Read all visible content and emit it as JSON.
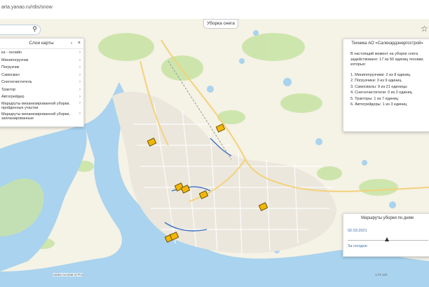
{
  "browser": {
    "url": "arta.yanao.ru/rdis/snow"
  },
  "map": {
    "search_icon": "search-icon",
    "top_button": "Уборка снега",
    "star_icon": "star-icon",
    "attribution": "Adobe Acrobat XI Pro",
    "scale": "1:72 124"
  },
  "layers_panel": {
    "title": "Слои карты",
    "items": [
      {
        "label": "ка - онлайн"
      },
      {
        "label": "Минипогрузчик"
      },
      {
        "label": "Погрузчик"
      },
      {
        "label": "Самосвал"
      },
      {
        "label": "Снегоочиститель"
      },
      {
        "label": "Трактор"
      },
      {
        "label": "Автогрейдер"
      },
      {
        "label": "Маршруты механизированной уборки, пройденные участки"
      },
      {
        "label": "Маршруты механизированной уборки, запланированные"
      }
    ]
  },
  "info_panel": {
    "title": "Техника АО «Салехардэнергострой»",
    "intro": "В настоящий момент на уборке снега задействовано: 17 из 50 единиц техники, которых:",
    "items": [
      {
        "label": "1. Минипогрузчики: 2 из 8 единиц"
      },
      {
        "label": "2. Погрузчики: 3 из 9 единиц"
      },
      {
        "label": "3. Самосвалы: 9 из 21 единицы"
      },
      {
        "label": "4. Снегоочистители: 0 из 2 единиц"
      },
      {
        "label": "5. Тракторы: 1 из 7 единиц"
      },
      {
        "label": "6. Автогрейдеры: 1 из 3 единиц"
      }
    ]
  },
  "routes_panel": {
    "title": "Маршруты уборки по дням",
    "date": "02.03.2021",
    "today": "За сегодня"
  },
  "colors": {
    "water": "#a9d3ee",
    "land": "#f5f2e6",
    "vegetation": "#c7e3a4",
    "city": "#ece8df",
    "equipment": "#f2b705"
  }
}
